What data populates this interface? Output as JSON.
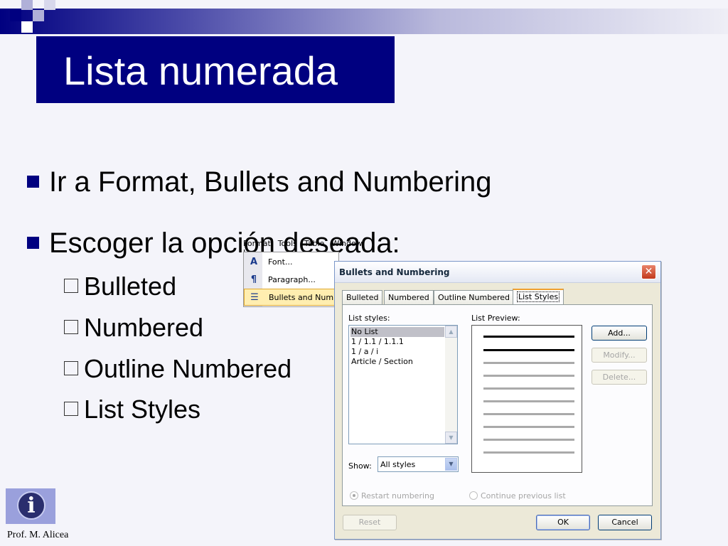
{
  "slide": {
    "title": "Lista numerada",
    "bullets": [
      "Ir a Format, Bullets and Numbering",
      "Escoger la opción deseada:"
    ],
    "subbullets": [
      "Bulleted",
      "Numbered",
      "Outline Numbered",
      "List Styles"
    ],
    "author": "Prof. M. Alicea",
    "colors": {
      "accent": "#000080",
      "background": "#f4f4fa"
    }
  },
  "menu": {
    "bar": [
      "Format",
      "Tools",
      "Table",
      "Window",
      "He"
    ],
    "items": [
      {
        "label": "Font...",
        "icon": "font-icon"
      },
      {
        "label": "Paragraph...",
        "icon": "paragraph-icon"
      },
      {
        "label": "Bullets and Numbe",
        "icon": "bullets-icon"
      }
    ]
  },
  "dialog": {
    "title": "Bullets and Numbering",
    "tabs": [
      "Bulleted",
      "Numbered",
      "Outline Numbered",
      "List Styles"
    ],
    "active_tab": "List Styles",
    "list_styles_label": "List styles:",
    "list_preview_label": "List Preview:",
    "list_items": [
      "No List",
      "1 / 1.1 / 1.1.1",
      "1 / a / i",
      "Article / Section"
    ],
    "selected_item": "No List",
    "buttons": {
      "add": "Add...",
      "modify": "Modify...",
      "delete": "Delete..."
    },
    "show_label": "Show:",
    "show_value": "All styles",
    "radio_restart": "Restart numbering",
    "radio_continue": "Continue previous list",
    "footer": {
      "reset": "Reset",
      "ok": "OK",
      "cancel": "Cancel"
    }
  }
}
